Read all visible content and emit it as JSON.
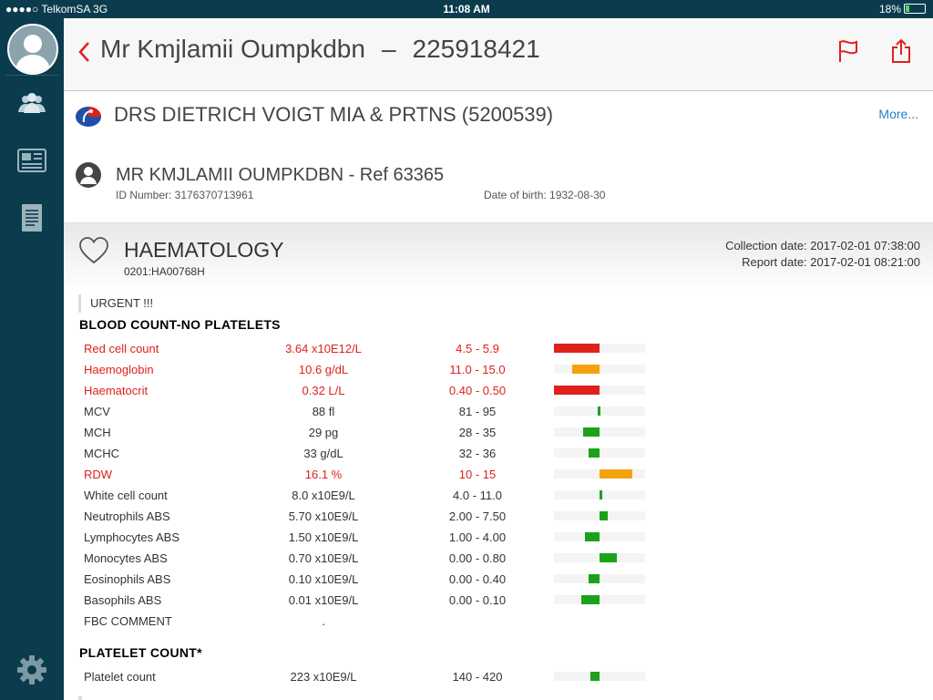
{
  "status_bar": {
    "carrier": "●●●●○ TelkomSA   3G",
    "time": "11:08 AM",
    "battery": "18%"
  },
  "header": {
    "patient_name": "Mr Kmjlamii Oumpkdbn",
    "separator": "–",
    "account_number": "225918421"
  },
  "practice": {
    "name": "DRS DIETRICH VOIGT MIA & PRTNS (5200539)",
    "more_label": "More..."
  },
  "patient": {
    "name": "MR KMJLAMII OUMPKDBN - Ref 63365",
    "id_number": "ID Number: 3176370713961",
    "dob": "Date of birth: 1932-08-30"
  },
  "report": {
    "title": "HAEMATOLOGY",
    "code": "0201:HA00768H",
    "collection_date": "Collection date: 2017-02-01 07:38:00",
    "report_date": "Report date: 2017-02-01 08:21:00",
    "urgent": "URGENT !!!"
  },
  "groups": [
    {
      "title": "BLOOD COUNT-NO PLATELETS"
    },
    {
      "title": "PLATELET COUNT*"
    }
  ],
  "colors": {
    "sidebar": "#0b3c4e",
    "abnormal": "#e0201b",
    "high": "#f5a30a",
    "normal": "#1aa31a",
    "link": "#2a7ec3"
  },
  "results": [
    {
      "name": "Red cell count",
      "value": "3.64 x10E12/L",
      "ref": "4.5 - 5.9",
      "abnormal": true,
      "bar_start": 0.0,
      "bar_end": 0.5,
      "bar_color": "abnormal"
    },
    {
      "name": "Haemoglobin",
      "value": "10.6 g/dL",
      "ref": "11.0 - 15.0",
      "abnormal": true,
      "bar_start": 0.2,
      "bar_end": 0.5,
      "bar_color": "high"
    },
    {
      "name": "Haematocrit",
      "value": "0.32 L/L",
      "ref": "0.40 - 0.50",
      "abnormal": true,
      "bar_start": 0.0,
      "bar_end": 0.5,
      "bar_color": "abnormal"
    },
    {
      "name": "MCV",
      "value": "88 fl",
      "ref": "81 - 95",
      "abnormal": false,
      "bar_start": 0.48,
      "bar_end": 0.51,
      "bar_color": "normal"
    },
    {
      "name": "MCH",
      "value": "29 pg",
      "ref": "28 - 35",
      "abnormal": false,
      "bar_start": 0.32,
      "bar_end": 0.5,
      "bar_color": "normal"
    },
    {
      "name": "MCHC",
      "value": "33 g/dL",
      "ref": "32 - 36",
      "abnormal": false,
      "bar_start": 0.38,
      "bar_end": 0.5,
      "bar_color": "normal"
    },
    {
      "name": "RDW",
      "value": "16.1 %",
      "ref": "10 - 15",
      "abnormal": true,
      "bar_start": 0.5,
      "bar_end": 0.86,
      "bar_color": "high"
    },
    {
      "name": "White cell count",
      "value": "8.0 x10E9/L",
      "ref": "4.0 - 11.0",
      "abnormal": false,
      "bar_start": 0.5,
      "bar_end": 0.53,
      "bar_color": "normal"
    },
    {
      "name": "Neutrophils ABS",
      "value": "5.70 x10E9/L",
      "ref": "2.00 - 7.50",
      "abnormal": false,
      "bar_start": 0.5,
      "bar_end": 0.59,
      "bar_color": "normal"
    },
    {
      "name": "Lymphocytes ABS",
      "value": "1.50 x10E9/L",
      "ref": "1.00 - 4.00",
      "abnormal": false,
      "bar_start": 0.34,
      "bar_end": 0.5,
      "bar_color": "normal"
    },
    {
      "name": "Monocytes ABS",
      "value": "0.70 x10E9/L",
      "ref": "0.00 - 0.80",
      "abnormal": false,
      "bar_start": 0.5,
      "bar_end": 0.69,
      "bar_color": "normal"
    },
    {
      "name": "Eosinophils ABS",
      "value": "0.10 x10E9/L",
      "ref": "0.00 - 0.40",
      "abnormal": false,
      "bar_start": 0.38,
      "bar_end": 0.5,
      "bar_color": "normal"
    },
    {
      "name": "Basophils ABS",
      "value": "0.01 x10E9/L",
      "ref": "0.00 - 0.10",
      "abnormal": false,
      "bar_start": 0.3,
      "bar_end": 0.5,
      "bar_color": "normal"
    },
    {
      "name": "FBC COMMENT",
      "value": ".",
      "ref": "",
      "abnormal": false,
      "bar_start": null,
      "bar_end": null,
      "bar_color": null
    },
    {
      "name": "Platelet count",
      "value": "223 x10E9/L",
      "ref": "140 - 420",
      "abnormal": false,
      "bar_start": 0.4,
      "bar_end": 0.5,
      "bar_color": "normal"
    }
  ]
}
